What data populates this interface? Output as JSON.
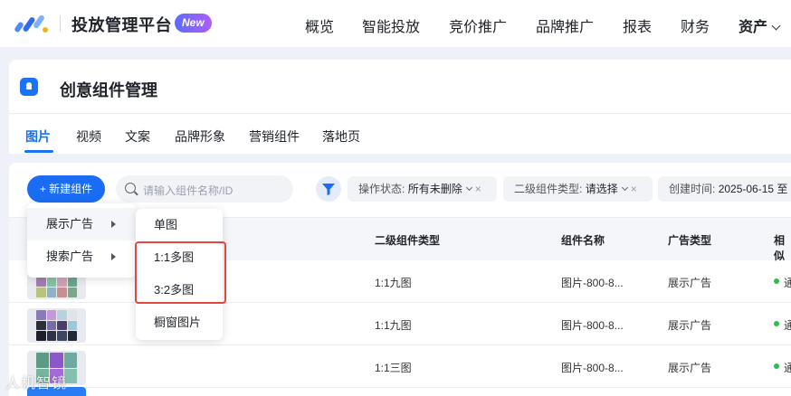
{
  "header": {
    "brand": "投放管理平台",
    "badge": "New",
    "nav": [
      "概览",
      "智能投放",
      "竞价推广",
      "品牌推广",
      "报表",
      "财务",
      "资产"
    ]
  },
  "page": {
    "title": "创意组件管理",
    "tabs": [
      "图片",
      "视频",
      "文案",
      "品牌形象",
      "营销组件",
      "落地页"
    ],
    "active_tab": "图片"
  },
  "toolbar": {
    "new_button": "+ 新建组件",
    "search_placeholder": "请输入组件名称/ID",
    "filters": [
      {
        "label": "操作状态:",
        "value": "所有未删除"
      },
      {
        "label": "二级组件类型:",
        "value": "请选择"
      },
      {
        "label": "创建时间:",
        "value": "2025-06-15 至"
      }
    ]
  },
  "table": {
    "columns": [
      "二级组件类型",
      "组件名称",
      "广告类型",
      "相似"
    ],
    "rows": [
      {
        "sub_type": "1:1九图",
        "name": "图片-800-8...",
        "ad_type": "展示广告",
        "status": "通"
      },
      {
        "sub_type": "1:1九图",
        "name": "图片-800-8...",
        "ad_type": "展示广告",
        "status": "通"
      },
      {
        "sub_type": "1:1三图",
        "name": "图片-800-8...",
        "ad_type": "展示广告",
        "status": "通"
      }
    ]
  },
  "dropdown": {
    "level1": [
      "展示广告",
      "搜索广告"
    ],
    "level2": [
      "单图",
      "1:1多图",
      "3:2多图",
      "橱窗图片"
    ]
  },
  "watermark": "人机智镜",
  "colors": {
    "primary": "#1a6cf5",
    "highlight_border": "#e2483d",
    "status_green": "#2dbf4c"
  }
}
